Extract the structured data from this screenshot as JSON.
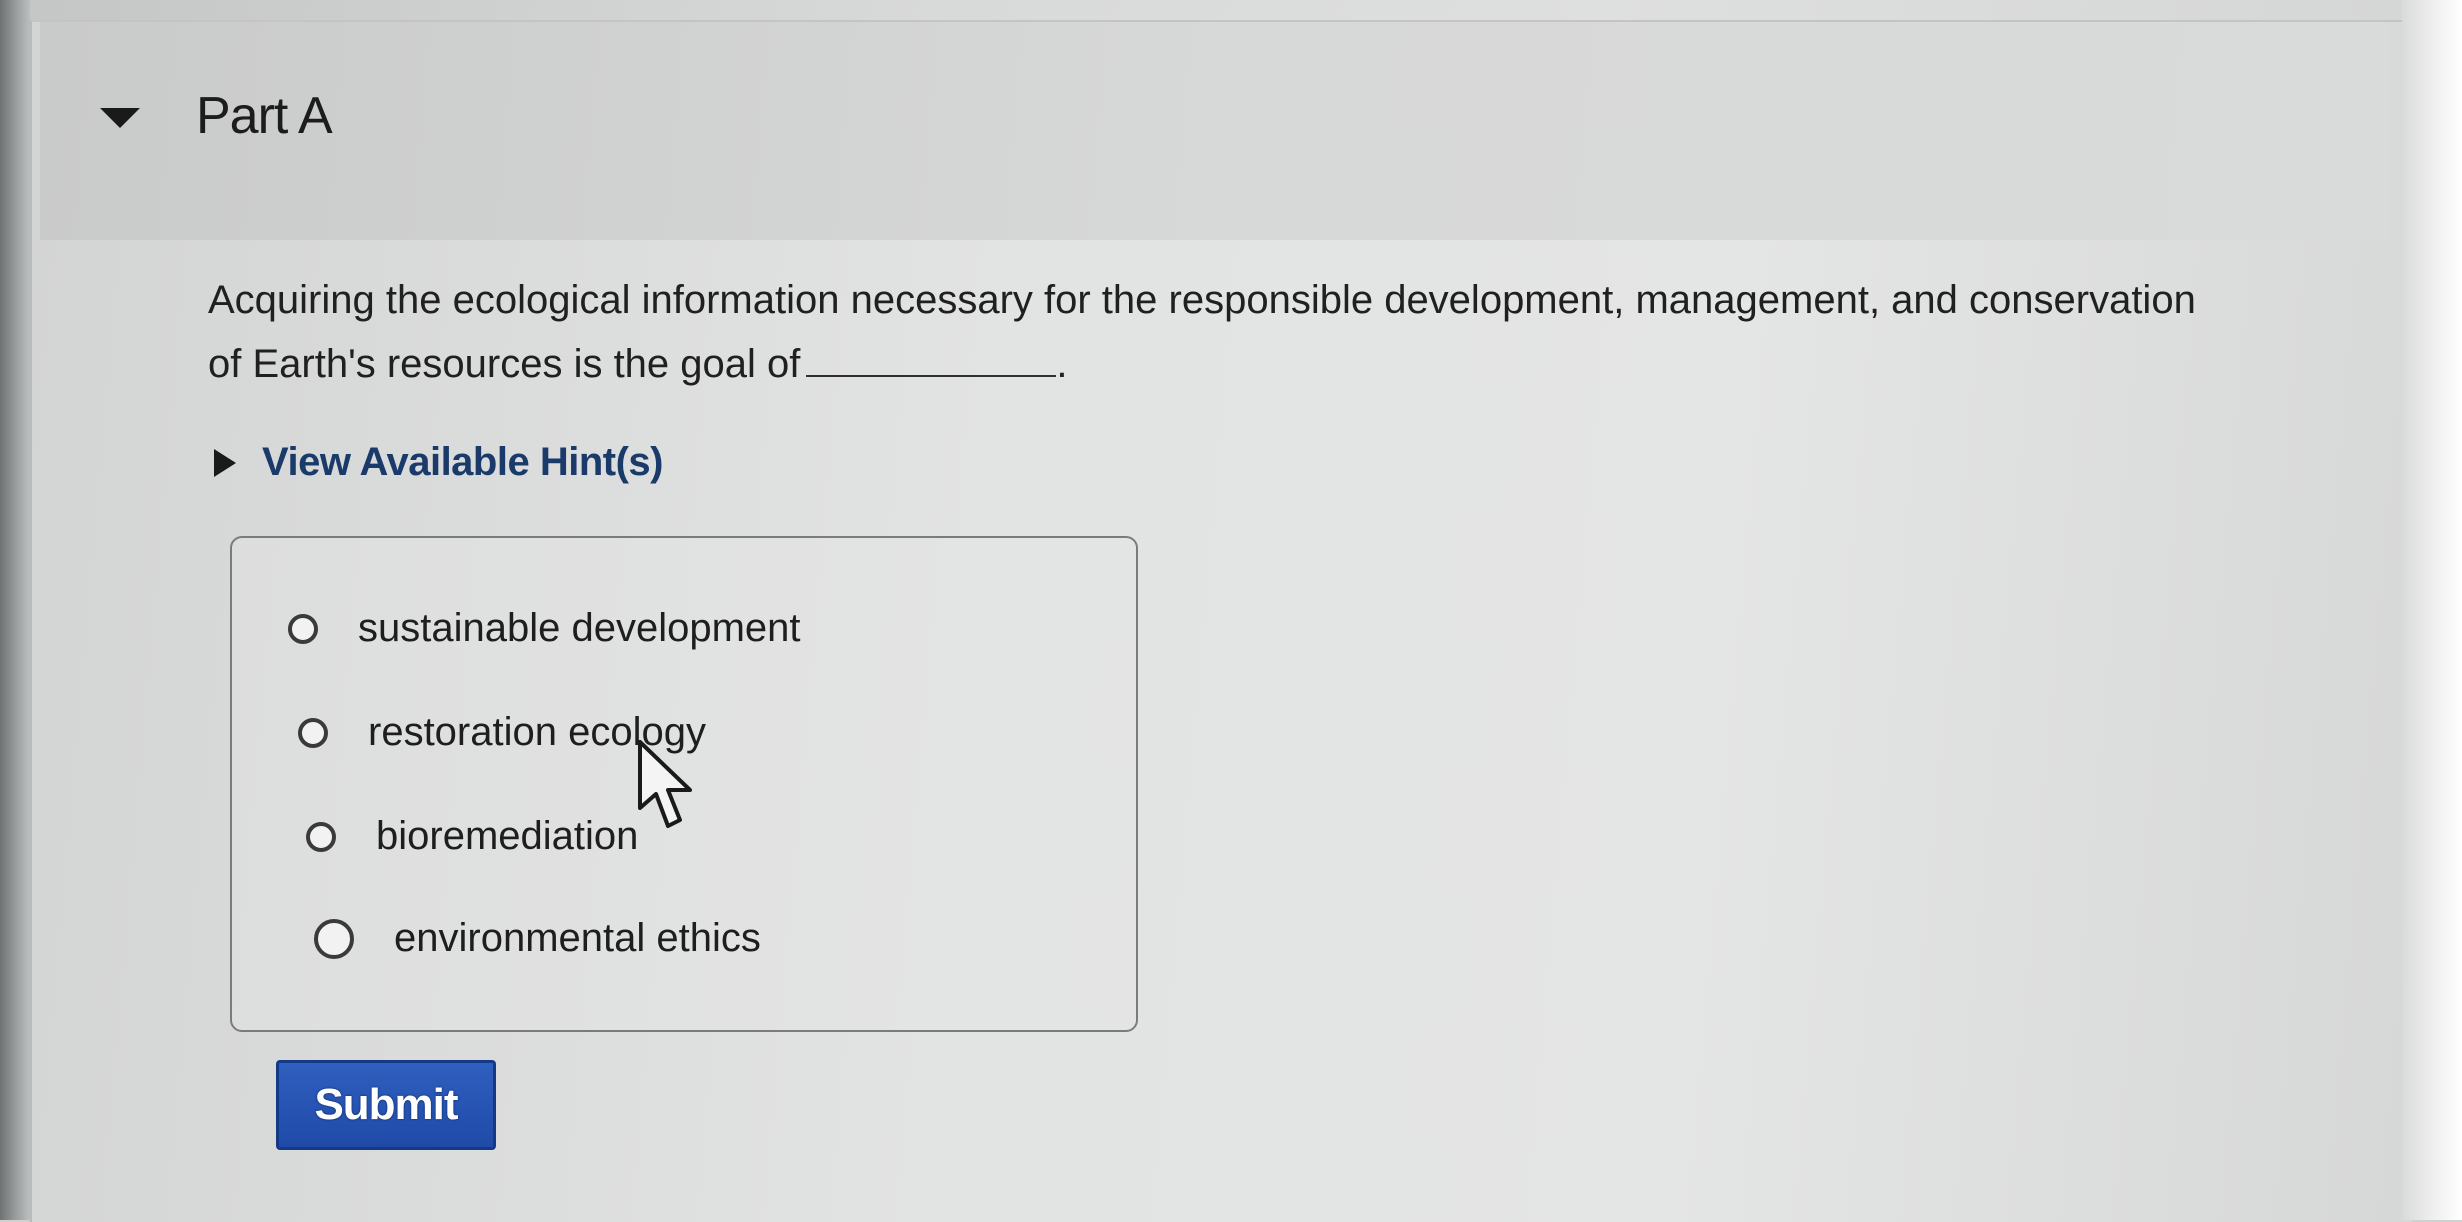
{
  "part": {
    "title": "Part A"
  },
  "question": {
    "text_before_blank": "Acquiring the ecological information necessary for the responsible development, management, and conservation of Earth's resources is the goal of",
    "text_after_blank": "."
  },
  "hints": {
    "label": "View Available Hint(s)"
  },
  "options": [
    {
      "label": "sustainable development"
    },
    {
      "label": "restoration ecology"
    },
    {
      "label": "bioremediation"
    },
    {
      "label": "environmental ethics"
    }
  ],
  "actions": {
    "submit_label": "Submit"
  },
  "icons": {
    "collapse": "triangle-down-icon",
    "hint_toggle": "triangle-right-icon",
    "cursor": "mouse-pointer-icon"
  },
  "colors": {
    "submit_bg": "#2f5fbf",
    "hint_link": "#1a3a6a"
  }
}
